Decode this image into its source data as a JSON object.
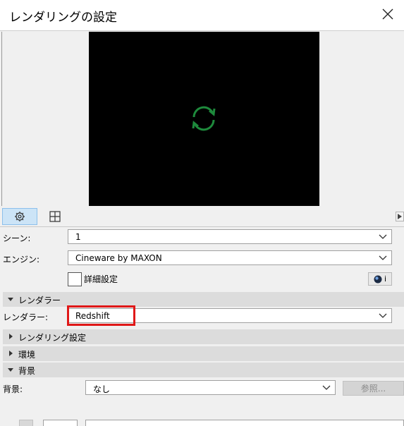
{
  "window": {
    "title": "レンダリングの設定"
  },
  "toolbar": {
    "tabs": [
      {
        "icon": "gear-icon"
      },
      {
        "icon": "grid-icon"
      }
    ]
  },
  "scene": {
    "label": "シーン:",
    "value": "1"
  },
  "engine": {
    "label": "エンジン:",
    "value": "Cineware by MAXON"
  },
  "details": {
    "checkbox_label": "詳細設定",
    "info_label": "i"
  },
  "sections": {
    "renderer": {
      "title": "レンダラー",
      "expanded": true
    },
    "rendering_settings": {
      "title": "レンダリング設定",
      "expanded": false
    },
    "environment": {
      "title": "環境",
      "expanded": false
    },
    "background": {
      "title": "背景",
      "expanded": true
    }
  },
  "renderer": {
    "label": "レンダラー:",
    "value": "Redshift"
  },
  "background": {
    "label": "背景:",
    "value": "なし",
    "browse_label": "参照..."
  },
  "colors": {
    "accent": "#cce4f7",
    "highlight": "#e01818",
    "spinner": "#1e8a3c"
  }
}
